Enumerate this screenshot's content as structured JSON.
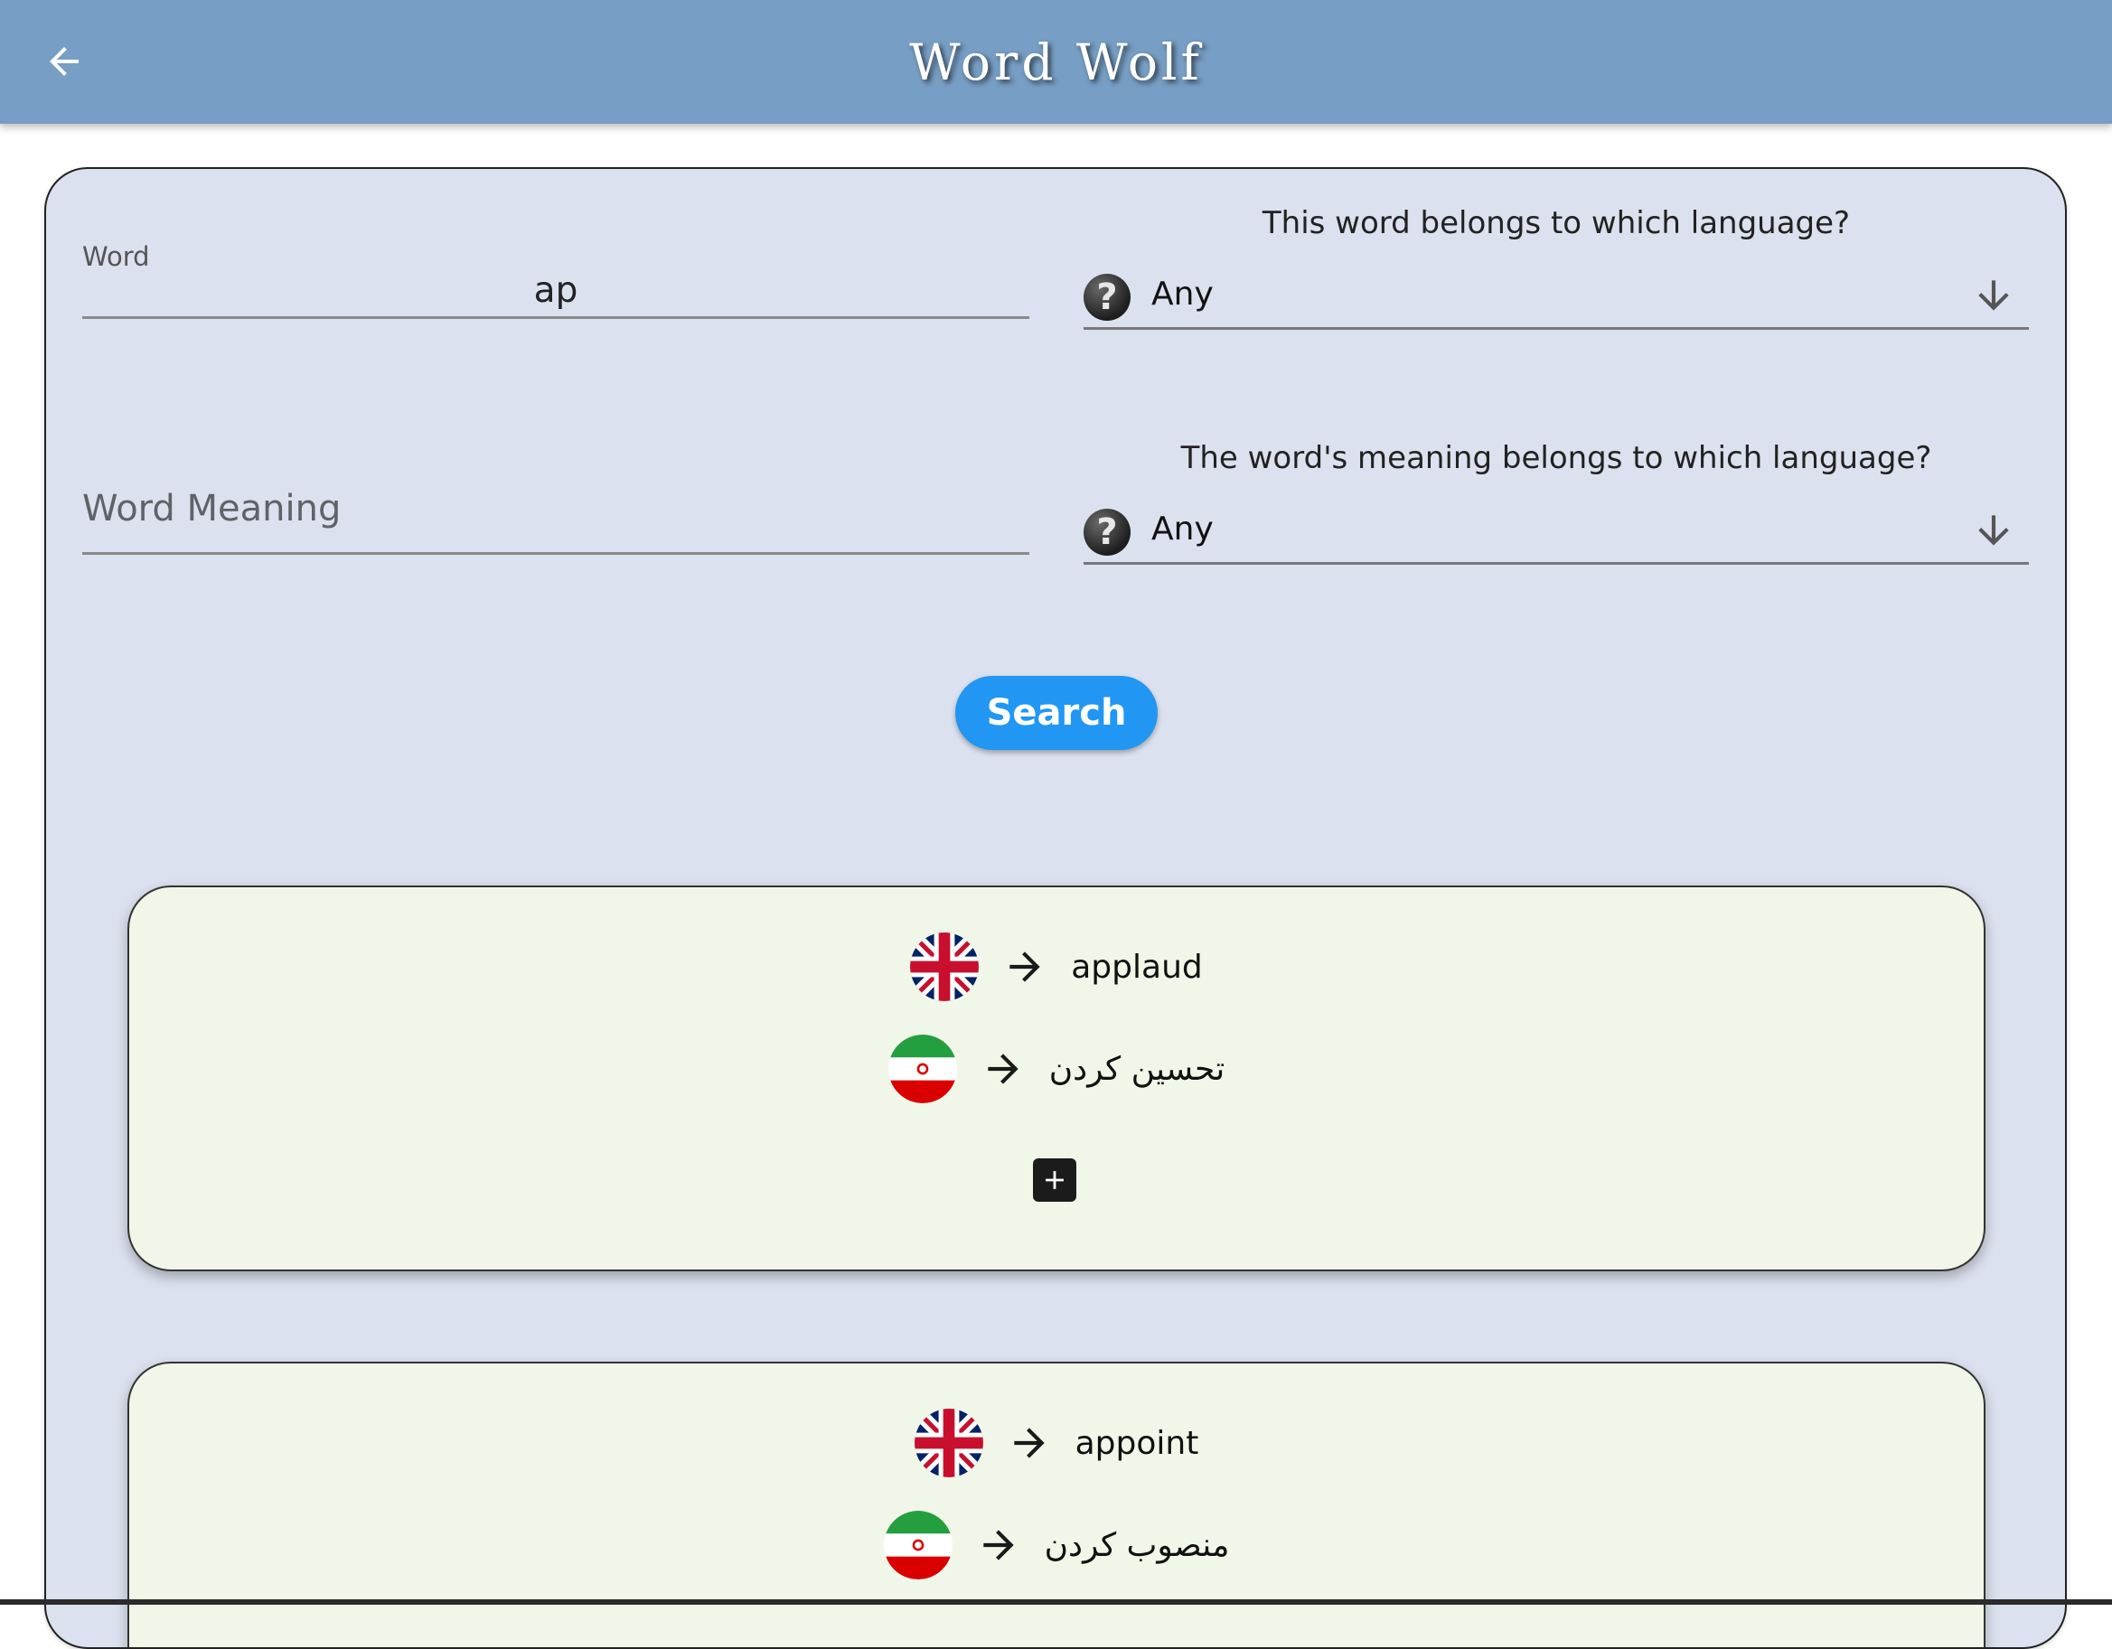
{
  "appbar": {
    "title": "Word  Wolf",
    "back_icon": "arrow-left-icon",
    "color": "#779ec4"
  },
  "form": {
    "word_field": {
      "label": "Word",
      "value": "ap"
    },
    "word_language": {
      "question": "This word belongs to which language?",
      "selected": "Any",
      "icon": "question-mark-icon"
    },
    "meaning_field": {
      "placeholder": "Word Meaning",
      "value": ""
    },
    "meaning_language": {
      "question": "The word's meaning belongs to which language?",
      "selected": "Any",
      "icon": "question-mark-icon"
    },
    "search_label": "Search",
    "search_color": "#2196f3"
  },
  "results": [
    {
      "word": "applaud",
      "word_flag": "uk-flag-icon",
      "meaning": "تحسین کردن",
      "meaning_flag": "iran-flag-icon",
      "add_icon": "add-box-icon"
    },
    {
      "word": "appoint",
      "word_flag": "uk-flag-icon",
      "meaning": "منصوب کردن",
      "meaning_flag": "iran-flag-icon"
    }
  ],
  "colors": {
    "panel_bg": "#dbe1ee",
    "card_bg": "#f1f7e8"
  }
}
